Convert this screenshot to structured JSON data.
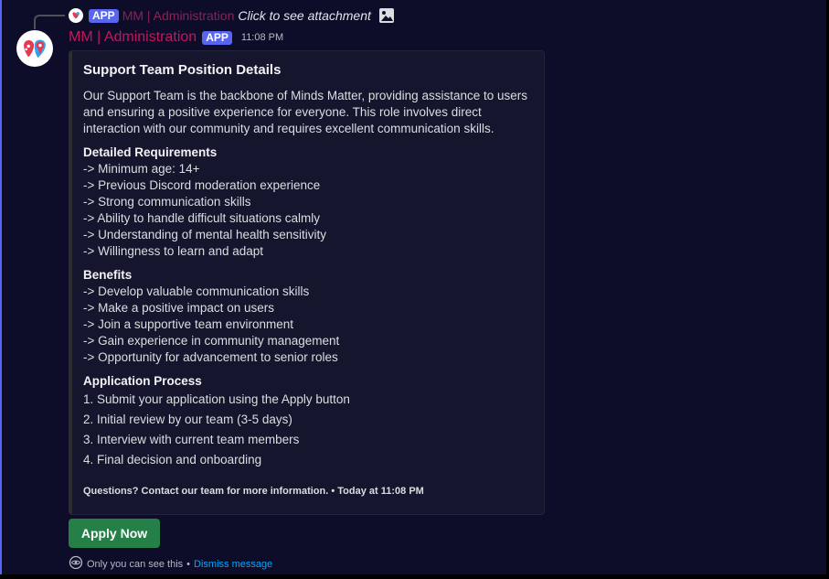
{
  "reply": {
    "badge": "APP",
    "author": "MM | Administration",
    "text": "Click to see attachment",
    "attachment_icon": "image-icon"
  },
  "message": {
    "author": "MM | Administration",
    "badge": "APP",
    "timestamp": "11:08 PM",
    "author_color": "#c2185b"
  },
  "embed": {
    "title": "Support Team Position Details",
    "description": "Our Support Team is the backbone of Minds Matter, providing assistance to users and ensuring a positive experience for everyone. This role involves direct interaction with our community and requires excellent communication skills.",
    "fields": [
      {
        "name": "Detailed Requirements",
        "lines": [
          "-> Minimum age: 14+",
          "-> Previous Discord moderation experience",
          "-> Strong communication skills",
          "-> Ability to handle difficult situations calmly",
          "-> Understanding of mental health sensitivity",
          "-> Willingness to learn and adapt"
        ]
      },
      {
        "name": "Benefits",
        "lines": [
          "-> Develop valuable communication skills",
          "-> Make a positive impact on users",
          "-> Join a supportive team environment",
          "-> Gain experience in community management",
          "-> Opportunity for advancement to senior roles"
        ]
      },
      {
        "name": "Application Process",
        "lines": [
          "1. Submit your application using the Apply button",
          "2. Initial review by our team (3-5 days)",
          "3. Interview with current team members",
          "4. Final decision and onboarding"
        ]
      }
    ],
    "footer": "Questions? Contact our team for more information. • Today at 11:08 PM"
  },
  "button": {
    "label": "Apply Now",
    "color": "#248046"
  },
  "ephemeral": {
    "text": "Only you can see this",
    "separator": "•",
    "dismiss": "Dismiss message",
    "icon": "eye-icon"
  },
  "colors": {
    "accent": "#5865f2",
    "background": "#0d0d2a",
    "link": "#00a8fc"
  }
}
